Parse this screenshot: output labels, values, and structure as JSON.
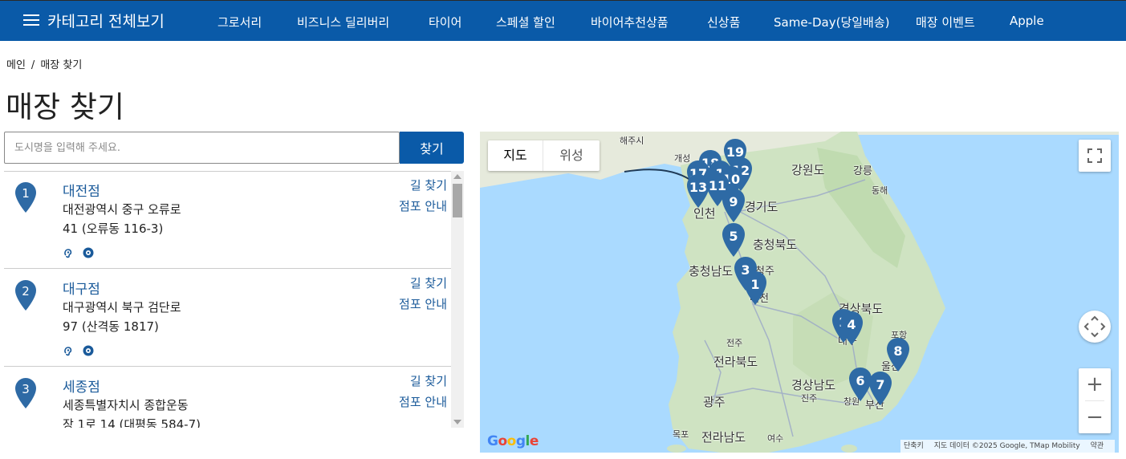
{
  "nav": {
    "category_all": "카테고리 전체보기",
    "items": [
      "그로서리",
      "비즈니스 딜리버리",
      "타이어",
      "스페셜 할인",
      "바이어추천상품",
      "신상품",
      "Same-Day(당일배송)",
      "매장 이벤트",
      "Apple"
    ]
  },
  "breadcrumb": {
    "home": "메인",
    "sep": "/",
    "current": "매장 찾기"
  },
  "page_title": "매장 찾기",
  "search": {
    "placeholder": "도시명을 입력해 주세요.",
    "button": "찾기"
  },
  "stores": [
    {
      "num": "1",
      "name": "대전점",
      "addr1": "대전광역시 중구 오류로",
      "addr2": "41 (오류동 116-3)",
      "dir": "길 찾기",
      "info": "점포 안내",
      "icons": [
        "hearing-aid-icon",
        "tire-icon"
      ]
    },
    {
      "num": "2",
      "name": "대구점",
      "addr1": "대구광역시 북구 검단로",
      "addr2": "97 (산격동 1817)",
      "dir": "길 찾기",
      "info": "점포 안내",
      "icons": [
        "hearing-aid-icon",
        "tire-icon"
      ]
    },
    {
      "num": "3",
      "name": "세종점",
      "addr1": "세종특별자치시 종합운동",
      "addr2": "장 1로 14 (대평동 584-7)",
      "dir": "길 찾기",
      "info": "점포 안내",
      "icons": []
    }
  ],
  "map": {
    "toggle": {
      "map": "지도",
      "satellite": "위성"
    },
    "labels": {
      "haeju": "해주시",
      "kaesong": "개성",
      "gangwon": "강원도",
      "gangneung": "강릉",
      "donghae": "동해",
      "incheon": "인천",
      "gyeonggi": "경기도",
      "chungbuk": "충청북도",
      "chungnam": "충청남도",
      "cheongju": "청주",
      "daejeon": "대전",
      "gyeongbuk": "경상북도",
      "pohang": "포항",
      "daegu": "대구",
      "jeonju": "전주",
      "jeonbuk": "전라북도",
      "ulsan": "울산",
      "gyeongnam": "경상남도",
      "jinju": "진주",
      "changwon": "창원",
      "busan": "부산",
      "gwangju": "광주",
      "mokpo": "목포",
      "jeonnam": "전라남도",
      "yeosu": "여수"
    },
    "markers": [
      "19",
      "18",
      "12",
      "17",
      "1",
      "10",
      "13",
      "11",
      "9",
      "5",
      "3",
      "1",
      "2",
      "4",
      "8",
      "6",
      "7"
    ],
    "google": "Google",
    "attribution": {
      "shortcuts": "단축키",
      "data": "지도 데이터 ©2025 Google, TMap Mobility",
      "terms": "약관"
    }
  },
  "colors": {
    "brand_blue": "#0a5aa8",
    "marker_blue": "#2e6aa5",
    "link_blue": "#1a5a9a",
    "sea": "#aadaff",
    "land": "#cfe3c2"
  }
}
